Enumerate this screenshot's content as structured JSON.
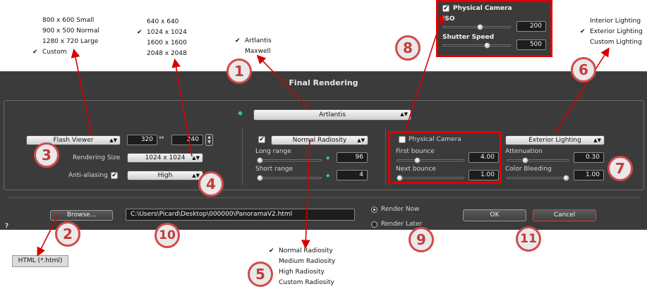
{
  "viewer_sizes_menu": {
    "items": [
      {
        "label": "800 x 600 Small",
        "checked": false
      },
      {
        "label": "900 x 500 Normal",
        "checked": false
      },
      {
        "label": "1280 x 720 Large",
        "checked": false
      },
      {
        "label": "Custom",
        "checked": true
      }
    ]
  },
  "rendering_size_menu": {
    "items": [
      {
        "label": "640 x 640",
        "checked": false
      },
      {
        "label": "1024 x 1024",
        "checked": true
      },
      {
        "label": "1600 x 1600",
        "checked": false
      },
      {
        "label": "2048 x 2048",
        "checked": false
      }
    ]
  },
  "engine_menu": {
    "items": [
      {
        "label": "Artlantis",
        "checked": true
      },
      {
        "label": "Maxwell",
        "checked": false
      }
    ]
  },
  "lighting_menu": {
    "items": [
      {
        "label": "Interior Lighting",
        "checked": false
      },
      {
        "label": "Exterior Lighting",
        "checked": true
      },
      {
        "label": "Custom Lighting",
        "checked": false
      }
    ]
  },
  "radiosity_menu": {
    "items": [
      {
        "label": "Normal Radiosity",
        "checked": true
      },
      {
        "label": "Medium Radiosity",
        "checked": false
      },
      {
        "label": "High Radiosity",
        "checked": false
      },
      {
        "label": "Custom Radiosity",
        "checked": false
      }
    ]
  },
  "physical_camera_popup": {
    "label": "Physical Camera",
    "checked": true,
    "iso_label": "ISO",
    "iso_value": "200",
    "iso_slider": 0.55,
    "shutter_label": "Shutter Speed",
    "shutter_value": "500",
    "shutter_slider": 0.65
  },
  "file_type_tag": "HTML (*.html)",
  "dialog": {
    "title": "Final Rendering",
    "engine_value": "Artlantis",
    "viewer_value": "Flash Viewer",
    "width_value": "320",
    "height_value": "240",
    "rendering_size_label": "Rendering Size",
    "rendering_size_value": "1024 x 1024",
    "antialiasing_label": "Anti-aliasing",
    "antialiasing_checked": true,
    "antialiasing_value": "High",
    "radiosity_checked": true,
    "radiosity_value": "Normal Radiosity",
    "long_range_label": "Long range",
    "long_range_value": "96",
    "long_range_slider": 0.02,
    "short_range_label": "Short range",
    "short_range_value": "4",
    "short_range_slider": 0.02,
    "physical_camera_label": "Physical Camera",
    "physical_camera_checked": false,
    "first_bounce_label": "First bounce",
    "first_bounce_value": "4.00",
    "first_bounce_slider": 0.3,
    "next_bounce_label": "Next bounce",
    "next_bounce_value": "1.00",
    "next_bounce_slider": 0.02,
    "lighting_value": "Exterior Lighting",
    "attenuation_label": "Attenuation",
    "attenuation_value": "0.30",
    "attenuation_slider": 0.3,
    "color_bleeding_label": "Color Bleeding",
    "color_bleeding_value": "1.00",
    "color_bleeding_slider": 0.98,
    "browse_label": "Browse...",
    "path_value": "C:\\Users\\Picard\\Desktop\\000000\\PanoramaV2.html",
    "render_now_label": "Render Now",
    "render_now_selected": true,
    "render_later_label": "Render Later",
    "render_later_selected": false,
    "ok_label": "OK",
    "cancel_label": "Cancel",
    "help_label": "?"
  },
  "badges": [
    "1",
    "2",
    "3",
    "4",
    "5",
    "6",
    "7",
    "8",
    "9",
    "10",
    "11"
  ],
  "colors": {
    "annotation_red": "#e10000",
    "badge_red": "#d24a4a",
    "dialog_bg": "#3b3b3b"
  }
}
